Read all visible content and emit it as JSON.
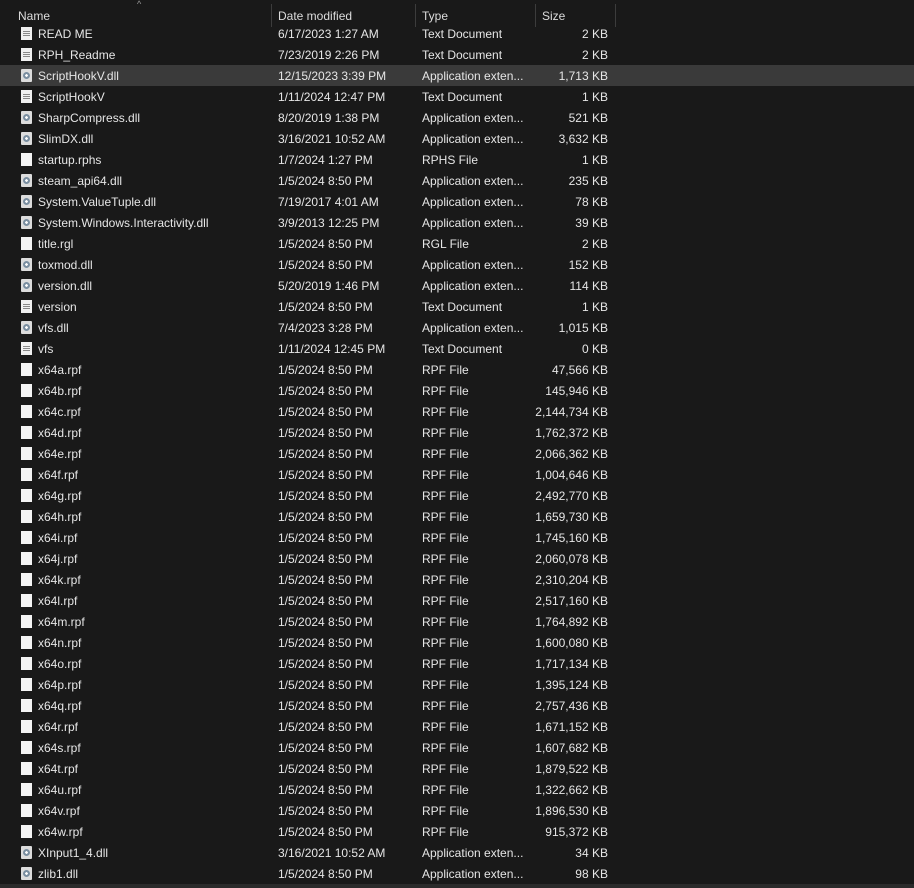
{
  "columns": {
    "name": "Name",
    "date": "Date modified",
    "type": "Type",
    "size": "Size"
  },
  "selected_index": 2,
  "files": [
    {
      "name": "READ ME",
      "date": "6/17/2023 1:27 AM",
      "type": "Text Document",
      "size": "2 KB",
      "icon": "text-document-icon"
    },
    {
      "name": "RPH_Readme",
      "date": "7/23/2019 2:26 PM",
      "type": "Text Document",
      "size": "2 KB",
      "icon": "text-document-icon"
    },
    {
      "name": "ScriptHookV.dll",
      "date": "12/15/2023 3:39 PM",
      "type": "Application exten...",
      "size": "1,713 KB",
      "icon": "dll-icon"
    },
    {
      "name": "ScriptHookV",
      "date": "1/11/2024 12:47 PM",
      "type": "Text Document",
      "size": "1 KB",
      "icon": "text-document-icon"
    },
    {
      "name": "SharpCompress.dll",
      "date": "8/20/2019 1:38 PM",
      "type": "Application exten...",
      "size": "521 KB",
      "icon": "dll-icon"
    },
    {
      "name": "SlimDX.dll",
      "date": "3/16/2021 10:52 AM",
      "type": "Application exten...",
      "size": "3,632 KB",
      "icon": "dll-icon"
    },
    {
      "name": "startup.rphs",
      "date": "1/7/2024 1:27 PM",
      "type": "RPHS File",
      "size": "1 KB",
      "icon": "blank-file-icon"
    },
    {
      "name": "steam_api64.dll",
      "date": "1/5/2024 8:50 PM",
      "type": "Application exten...",
      "size": "235 KB",
      "icon": "dll-icon"
    },
    {
      "name": "System.ValueTuple.dll",
      "date": "7/19/2017 4:01 AM",
      "type": "Application exten...",
      "size": "78 KB",
      "icon": "dll-icon"
    },
    {
      "name": "System.Windows.Interactivity.dll",
      "date": "3/9/2013 12:25 PM",
      "type": "Application exten...",
      "size": "39 KB",
      "icon": "dll-icon"
    },
    {
      "name": "title.rgl",
      "date": "1/5/2024 8:50 PM",
      "type": "RGL File",
      "size": "2 KB",
      "icon": "blank-file-icon"
    },
    {
      "name": "toxmod.dll",
      "date": "1/5/2024 8:50 PM",
      "type": "Application exten...",
      "size": "152 KB",
      "icon": "dll-icon"
    },
    {
      "name": "version.dll",
      "date": "5/20/2019 1:46 PM",
      "type": "Application exten...",
      "size": "114 KB",
      "icon": "dll-icon"
    },
    {
      "name": "version",
      "date": "1/5/2024 8:50 PM",
      "type": "Text Document",
      "size": "1 KB",
      "icon": "text-document-icon"
    },
    {
      "name": "vfs.dll",
      "date": "7/4/2023 3:28 PM",
      "type": "Application exten...",
      "size": "1,015 KB",
      "icon": "dll-icon"
    },
    {
      "name": "vfs",
      "date": "1/11/2024 12:45 PM",
      "type": "Text Document",
      "size": "0 KB",
      "icon": "text-document-icon"
    },
    {
      "name": "x64a.rpf",
      "date": "1/5/2024 8:50 PM",
      "type": "RPF File",
      "size": "47,566 KB",
      "icon": "blank-file-icon"
    },
    {
      "name": "x64b.rpf",
      "date": "1/5/2024 8:50 PM",
      "type": "RPF File",
      "size": "145,946 KB",
      "icon": "blank-file-icon"
    },
    {
      "name": "x64c.rpf",
      "date": "1/5/2024 8:50 PM",
      "type": "RPF File",
      "size": "2,144,734 KB",
      "icon": "blank-file-icon"
    },
    {
      "name": "x64d.rpf",
      "date": "1/5/2024 8:50 PM",
      "type": "RPF File",
      "size": "1,762,372 KB",
      "icon": "blank-file-icon"
    },
    {
      "name": "x64e.rpf",
      "date": "1/5/2024 8:50 PM",
      "type": "RPF File",
      "size": "2,066,362 KB",
      "icon": "blank-file-icon"
    },
    {
      "name": "x64f.rpf",
      "date": "1/5/2024 8:50 PM",
      "type": "RPF File",
      "size": "1,004,646 KB",
      "icon": "blank-file-icon"
    },
    {
      "name": "x64g.rpf",
      "date": "1/5/2024 8:50 PM",
      "type": "RPF File",
      "size": "2,492,770 KB",
      "icon": "blank-file-icon"
    },
    {
      "name": "x64h.rpf",
      "date": "1/5/2024 8:50 PM",
      "type": "RPF File",
      "size": "1,659,730 KB",
      "icon": "blank-file-icon"
    },
    {
      "name": "x64i.rpf",
      "date": "1/5/2024 8:50 PM",
      "type": "RPF File",
      "size": "1,745,160 KB",
      "icon": "blank-file-icon"
    },
    {
      "name": "x64j.rpf",
      "date": "1/5/2024 8:50 PM",
      "type": "RPF File",
      "size": "2,060,078 KB",
      "icon": "blank-file-icon"
    },
    {
      "name": "x64k.rpf",
      "date": "1/5/2024 8:50 PM",
      "type": "RPF File",
      "size": "2,310,204 KB",
      "icon": "blank-file-icon"
    },
    {
      "name": "x64l.rpf",
      "date": "1/5/2024 8:50 PM",
      "type": "RPF File",
      "size": "2,517,160 KB",
      "icon": "blank-file-icon"
    },
    {
      "name": "x64m.rpf",
      "date": "1/5/2024 8:50 PM",
      "type": "RPF File",
      "size": "1,764,892 KB",
      "icon": "blank-file-icon"
    },
    {
      "name": "x64n.rpf",
      "date": "1/5/2024 8:50 PM",
      "type": "RPF File",
      "size": "1,600,080 KB",
      "icon": "blank-file-icon"
    },
    {
      "name": "x64o.rpf",
      "date": "1/5/2024 8:50 PM",
      "type": "RPF File",
      "size": "1,717,134 KB",
      "icon": "blank-file-icon"
    },
    {
      "name": "x64p.rpf",
      "date": "1/5/2024 8:50 PM",
      "type": "RPF File",
      "size": "1,395,124 KB",
      "icon": "blank-file-icon"
    },
    {
      "name": "x64q.rpf",
      "date": "1/5/2024 8:50 PM",
      "type": "RPF File",
      "size": "2,757,436 KB",
      "icon": "blank-file-icon"
    },
    {
      "name": "x64r.rpf",
      "date": "1/5/2024 8:50 PM",
      "type": "RPF File",
      "size": "1,671,152 KB",
      "icon": "blank-file-icon"
    },
    {
      "name": "x64s.rpf",
      "date": "1/5/2024 8:50 PM",
      "type": "RPF File",
      "size": "1,607,682 KB",
      "icon": "blank-file-icon"
    },
    {
      "name": "x64t.rpf",
      "date": "1/5/2024 8:50 PM",
      "type": "RPF File",
      "size": "1,879,522 KB",
      "icon": "blank-file-icon"
    },
    {
      "name": "x64u.rpf",
      "date": "1/5/2024 8:50 PM",
      "type": "RPF File",
      "size": "1,322,662 KB",
      "icon": "blank-file-icon"
    },
    {
      "name": "x64v.rpf",
      "date": "1/5/2024 8:50 PM",
      "type": "RPF File",
      "size": "1,896,530 KB",
      "icon": "blank-file-icon"
    },
    {
      "name": "x64w.rpf",
      "date": "1/5/2024 8:50 PM",
      "type": "RPF File",
      "size": "915,372 KB",
      "icon": "blank-file-icon"
    },
    {
      "name": "XInput1_4.dll",
      "date": "3/16/2021 10:52 AM",
      "type": "Application exten...",
      "size": "34 KB",
      "icon": "dll-icon"
    },
    {
      "name": "zlib1.dll",
      "date": "1/5/2024 8:50 PM",
      "type": "Application exten...",
      "size": "98 KB",
      "icon": "dll-icon"
    }
  ]
}
